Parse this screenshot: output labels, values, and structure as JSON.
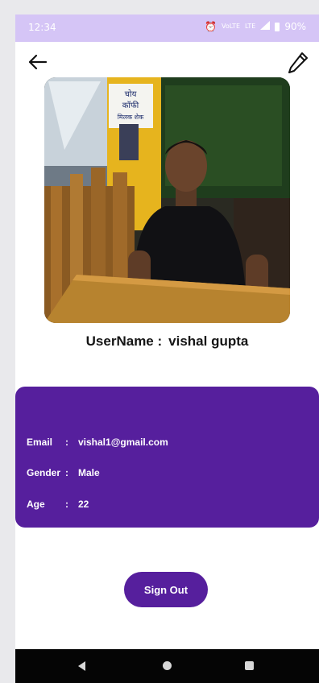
{
  "status_bar": {
    "time": "12:34",
    "network_small": "VoLTE",
    "network_type": "LTE",
    "battery": "90%"
  },
  "icons": {
    "back": "back-arrow-icon",
    "edit": "pencil-icon"
  },
  "profile": {
    "username_label": "UserName :",
    "username_value": "vishal gupta",
    "email_label": "Email",
    "email_value": "vishal1@gmail.com",
    "gender_label": "Gender",
    "gender_value": "Male",
    "age_label": "Age",
    "age_value": "22",
    "separator": ":"
  },
  "photo": {
    "sign_line1": "चोय",
    "sign_line2": "कॉफी",
    "sign_line3": "मिलक शेक"
  },
  "actions": {
    "sign_out": "Sign Out"
  },
  "colors": {
    "status_bar": "#d5c5f6",
    "accent": "#561f9d",
    "nav_bar": "#050505"
  }
}
